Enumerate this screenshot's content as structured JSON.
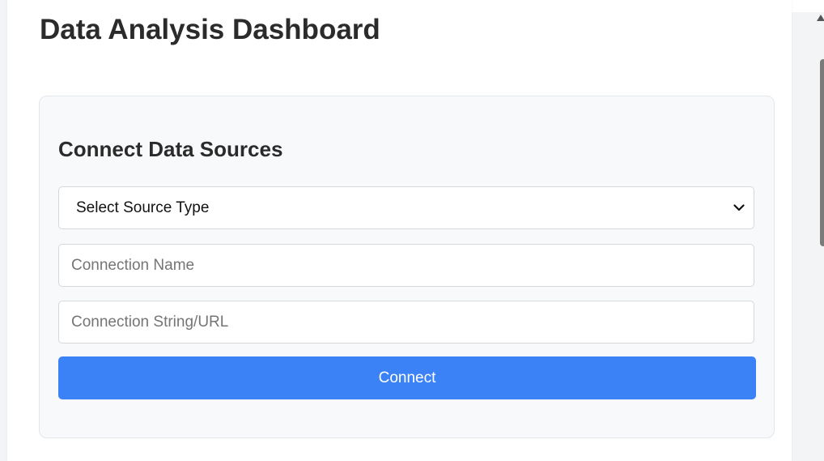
{
  "page": {
    "title": "Data Analysis Dashboard"
  },
  "connect_panel": {
    "title": "Connect Data Sources",
    "source_type_select": {
      "selected": "Select Source Type",
      "icon": "chevron-down-icon"
    },
    "connection_name": {
      "value": "",
      "placeholder": "Connection Name"
    },
    "connection_url": {
      "value": "",
      "placeholder": "Connection String/URL"
    },
    "connect_button_label": "Connect"
  },
  "colors": {
    "primary": "#3b82f6",
    "panel_bg": "#f8f9fb",
    "text": "#2b2b2b"
  }
}
